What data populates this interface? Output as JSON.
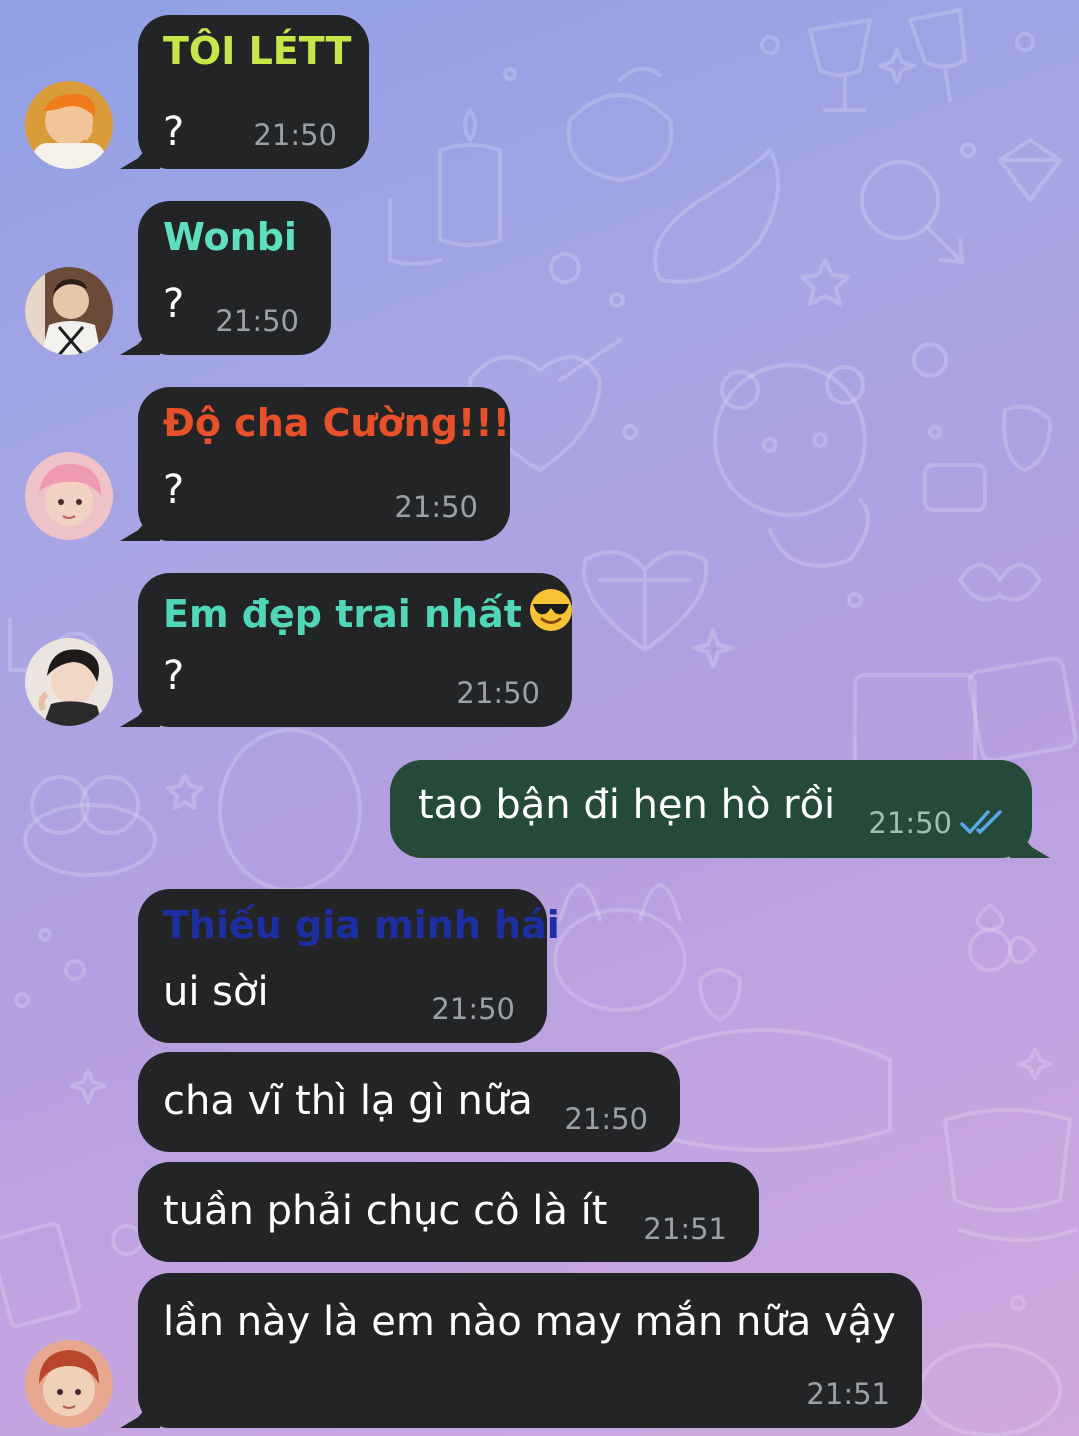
{
  "colors": {
    "incoming_bubble": "#222426",
    "outgoing_bubble": "#264a39",
    "timestamp": "#9aa0a6",
    "read_ticks": "#5aa9e6"
  },
  "messages": [
    {
      "sender": "TÔI LÉTT",
      "sender_color": "#c8e64a",
      "text": "?",
      "time": "21:50"
    },
    {
      "sender": "Wonbi",
      "sender_color": "#5ee0c0",
      "text": "?",
      "time": "21:50"
    },
    {
      "sender": "Độ cha Cường!!!",
      "sender_color": "#e8502a",
      "text": "?",
      "time": "21:50"
    },
    {
      "sender": "Em đẹp trai nhất",
      "sender_emoji": "smiling-face-with-sunglasses",
      "sender_color": "#52d6b8",
      "text": "?",
      "time": "21:50"
    },
    {
      "direction": "outgoing",
      "text": "tao bận đi hẹn hò rồi",
      "time": "21:50",
      "status": "read"
    },
    {
      "sender": "Thiếu gia minh hái",
      "sender_color": "#1d2fa0",
      "text": "ui sời",
      "time": "21:50"
    },
    {
      "text": "cha vĩ thì lạ gì nữa",
      "time": "21:50"
    },
    {
      "text": "tuần phải chục cô là ít",
      "time": "21:51"
    },
    {
      "text": "lần này là em nào may mắn nữa vậy",
      "time": "21:51"
    }
  ]
}
